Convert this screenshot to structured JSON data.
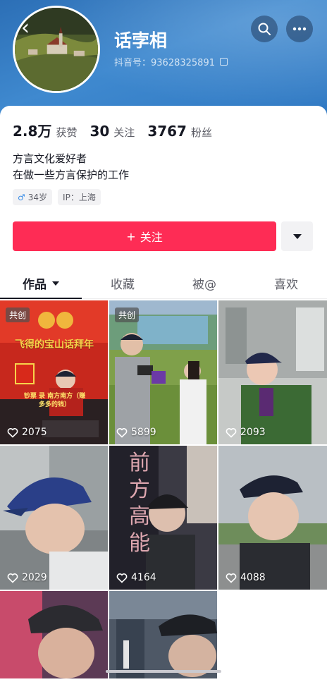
{
  "header": {
    "username": "话孛相",
    "douyin_id": "抖音号：93628325891",
    "back_icon": "back-arrow-icon",
    "search_icon": "search-icon",
    "more_icon": "more-dots-icon"
  },
  "stats": [
    {
      "num": "2.8万",
      "label": "获赞"
    },
    {
      "num": "30",
      "label": "关注"
    },
    {
      "num": "3767",
      "label": "粉丝"
    }
  ],
  "bio": {
    "line1": "方言文化爱好者",
    "line2": "在做一些方言保护的工作"
  },
  "tags": {
    "age": "34岁",
    "gender_symbol": "♂",
    "ip": "IP：上海"
  },
  "follow_button": {
    "label": "关注",
    "plus": "+"
  },
  "tabs": [
    "作品",
    "收藏",
    "被@",
    "喜欢"
  ],
  "videos": [
    {
      "badge": "共创",
      "likes": "2075",
      "title": "飞得的宝山话拜年",
      "sub": "钞票 录 南方南方（赚多多的钱）"
    },
    {
      "badge": "共创",
      "likes": "5899"
    },
    {
      "likes": "2093"
    },
    {
      "likes": "2029"
    },
    {
      "likes": "4164",
      "neon": "前方高能"
    },
    {
      "likes": "4088"
    },
    {},
    {}
  ],
  "colors": {
    "accent": "#fe2c55",
    "header_blue": "#3f89cf"
  }
}
